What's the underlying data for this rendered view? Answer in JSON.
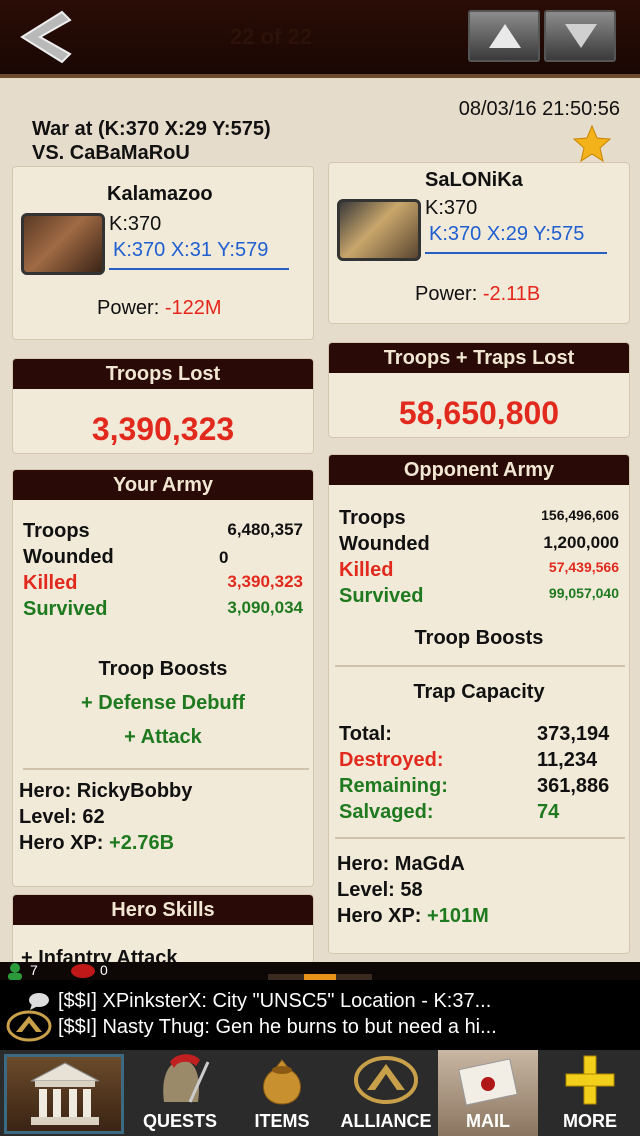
{
  "topbar": {
    "pager": "22 of 22"
  },
  "header": {
    "date": "08/03/16 21:50:56",
    "war_at": "War at (K:370 X:29 Y:575)",
    "vs": "VS. CaBaMaRoU"
  },
  "you": {
    "name": "Kalamazoo",
    "kingdom": "K:370",
    "coords": "K:370 X:31 Y:579",
    "power_label": "Power:",
    "power_value": "-122M",
    "troops_lost_title": "Troops Lost",
    "troops_lost": "3,390,323",
    "army_title": "Your Army",
    "army": {
      "troops_label": "Troops",
      "troops": "6,480,357",
      "wounded_label": "Wounded",
      "wounded": "0",
      "killed_label": "Killed",
      "killed": "3,390,323",
      "survived_label": "Survived",
      "survived": "3,090,034"
    },
    "boosts_title": "Troop Boosts",
    "boosts": [
      "+ Defense Debuff",
      "+ Attack"
    ],
    "hero_name": "Hero: RickyBobby",
    "hero_level": "Level: 62",
    "hero_xp_label": "Hero XP:",
    "hero_xp": "+2.76B",
    "hero_skills_title": "Hero Skills",
    "hero_skill_1": "+ Infantry Attack"
  },
  "opponent": {
    "name": "SaLONiKa",
    "kingdom": "K:370",
    "coords": "K:370 X:29 Y:575",
    "power_label": "Power:",
    "power_value": "-2.11B",
    "lost_title": "Troops + Traps Lost",
    "lost": "58,650,800",
    "army_title": "Opponent Army",
    "army": {
      "troops_label": "Troops",
      "troops": "156,496,606",
      "wounded_label": "Wounded",
      "wounded": "1,200,000",
      "killed_label": "Killed",
      "killed": "57,439,566",
      "survived_label": "Survived",
      "survived": "99,057,040"
    },
    "boosts_title": "Troop Boosts",
    "trap_title": "Trap Capacity",
    "trap": {
      "total_label": "Total:",
      "total": "373,194",
      "destroyed_label": "Destroyed:",
      "destroyed": "11,234",
      "remaining_label": "Remaining:",
      "remaining": "361,886",
      "salvaged_label": "Salvaged:",
      "salvaged": "74"
    },
    "hero_name": "Hero: MaGdA",
    "hero_level": "Level: 58",
    "hero_xp_label": "Hero XP:",
    "hero_xp": "+101M"
  },
  "status": {
    "members": "7",
    "messages": "0"
  },
  "chat": [
    "[$$I] XPinksterX: City \"UNSC5\" Location - K:37...",
    "[$$I] Nasty Thug: Gen he burns to but need a hi..."
  ],
  "nav": {
    "quests": "QUESTS",
    "items": "ITEMS",
    "alliance": "ALLIANCE",
    "mail": "MAIL",
    "more": "MORE"
  }
}
